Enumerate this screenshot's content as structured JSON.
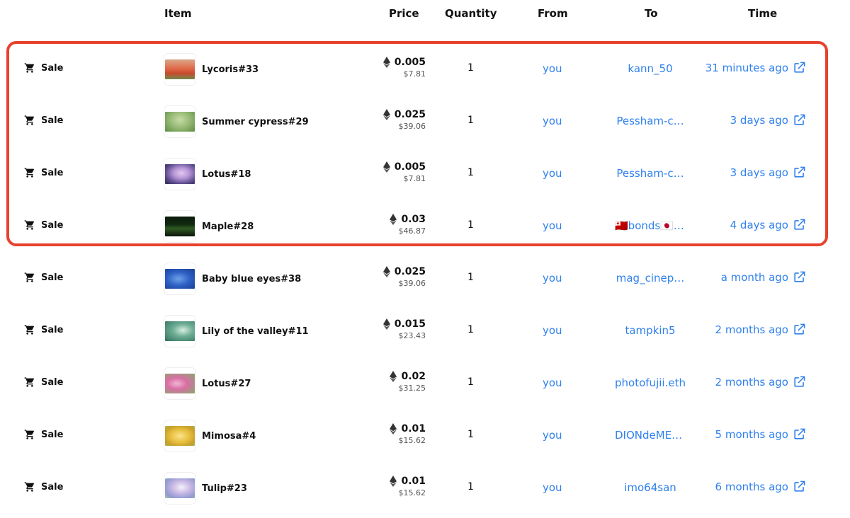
{
  "header": {
    "item": "Item",
    "price": "Price",
    "quantity": "Quantity",
    "from": "From",
    "to": "To",
    "time": "Time"
  },
  "colors": {
    "link": "#2f80ed",
    "highlight": "#e8412e"
  },
  "rows": [
    {
      "event": "Sale",
      "item": "Lycoris#33",
      "eth": "0.005",
      "usd": "$7.81",
      "qty": "1",
      "from": "you",
      "to": "kann_50",
      "time": "31 minutes ago"
    },
    {
      "event": "Sale",
      "item": "Summer cypress#29",
      "eth": "0.025",
      "usd": "$39.06",
      "qty": "1",
      "from": "you",
      "to": "Pessham-c…",
      "time": "3 days ago"
    },
    {
      "event": "Sale",
      "item": "Lotus#18",
      "eth": "0.005",
      "usd": "$7.81",
      "qty": "1",
      "from": "you",
      "to": "Pessham-c…",
      "time": "3 days ago"
    },
    {
      "event": "Sale",
      "item": "Maple#28",
      "eth": "0.03",
      "usd": "$46.87",
      "qty": "1",
      "from": "you",
      "to": "🇹🇴bonds🇯🇵.e…",
      "time": "4 days ago"
    },
    {
      "event": "Sale",
      "item": "Baby blue eyes#38",
      "eth": "0.025",
      "usd": "$39.06",
      "qty": "1",
      "from": "you",
      "to": "mag_cinep…",
      "time": "a month ago"
    },
    {
      "event": "Sale",
      "item": "Lily of the valley#11",
      "eth": "0.015",
      "usd": "$23.43",
      "qty": "1",
      "from": "you",
      "to": "tampkin5",
      "time": "2 months ago"
    },
    {
      "event": "Sale",
      "item": "Lotus#27",
      "eth": "0.02",
      "usd": "$31.25",
      "qty": "1",
      "from": "you",
      "to": "photofujii.eth",
      "time": "2 months ago"
    },
    {
      "event": "Sale",
      "item": "Mimosa#4",
      "eth": "0.01",
      "usd": "$15.62",
      "qty": "1",
      "from": "you",
      "to": "DIONdeMEDI…",
      "time": "5 months ago"
    },
    {
      "event": "Sale",
      "item": "Tulip#23",
      "eth": "0.01",
      "usd": "$15.62",
      "qty": "1",
      "from": "you",
      "to": "imo64san",
      "time": "6 months ago"
    }
  ]
}
